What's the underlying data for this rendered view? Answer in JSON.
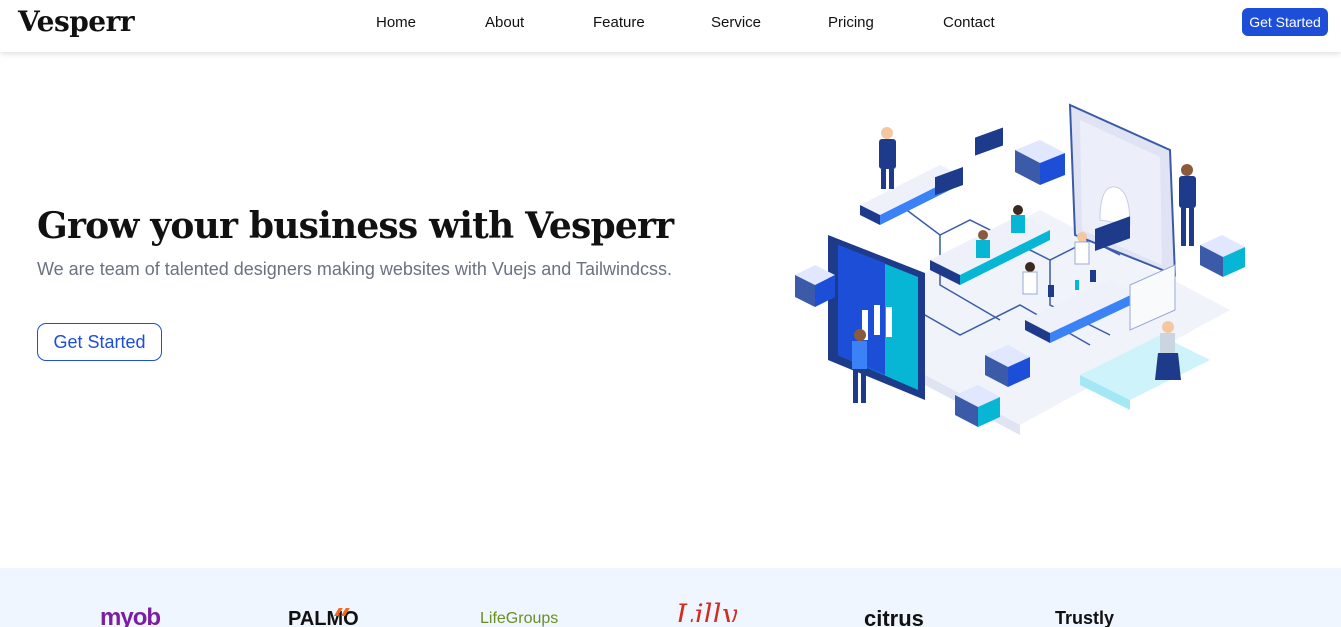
{
  "nav": {
    "brand": "Vesperr",
    "items": [
      {
        "label": "Home"
      },
      {
        "label": "About"
      },
      {
        "label": "Feature"
      },
      {
        "label": "Service"
      },
      {
        "label": "Pricing"
      },
      {
        "label": "Contact"
      }
    ],
    "cta_label": "Get Started"
  },
  "hero": {
    "title": "Grow your business with Vesperr",
    "subtitle": "We are team of talented designers making websites with Vuejs and Tailwindcss.",
    "cta_label": "Get Started",
    "illustration": "isometric-office-team-illustration"
  },
  "clients": {
    "logos": [
      {
        "name": "myob"
      },
      {
        "name": "PALMO"
      },
      {
        "name": "LifeGroups"
      },
      {
        "name": "Lilly"
      },
      {
        "name": "citrus"
      },
      {
        "name": "Trustly"
      }
    ]
  },
  "colors": {
    "accent": "#1d4ed8",
    "subtitle_text": "#6b7280",
    "strip_background": "#eff6ff"
  }
}
